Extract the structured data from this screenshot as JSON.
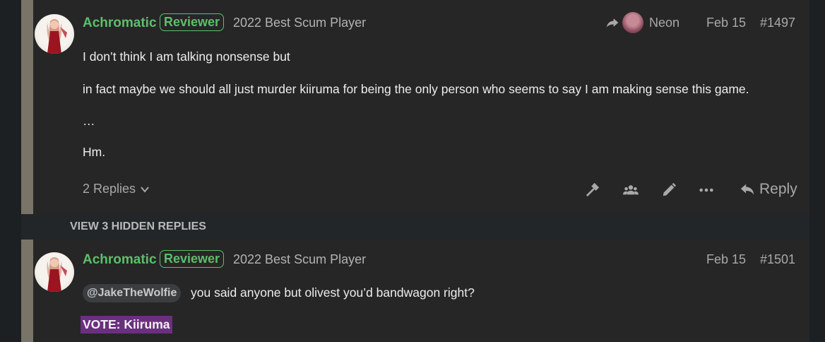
{
  "colors": {
    "username": "#5cbf6b",
    "page_bg": "#1d2023",
    "post_bg": "#262626",
    "left_bar": "#7a7468",
    "vote_bg": "#6b2f7f"
  },
  "post1": {
    "username": "Achromatic",
    "badge": "Reviewer",
    "user_title": "2022 Best Scum Player",
    "reply_to_name": "Neon",
    "date": "Feb 15",
    "post_number": "#1497",
    "lines": [
      "I don’t think I am talking nonsense but",
      "in fact maybe we should all just murder kiiruma for being the only person who seems to say I am making sense this game.",
      "…",
      "Hm."
    ],
    "replies_label": "2 Replies",
    "actions": [
      "hammer-icon",
      "group-icon",
      "pencil-icon",
      "more-icon"
    ],
    "reply_label": "Reply"
  },
  "hidden_replies": {
    "label": "VIEW 3 HIDDEN REPLIES"
  },
  "post2": {
    "username": "Achromatic",
    "badge": "Reviewer",
    "user_title": "2022 Best Scum Player",
    "date": "Feb 15",
    "post_number": "#1501",
    "mention": "@JakeTheWolfie",
    "text_after_mention": "you said anyone but olivest you’d bandwagon right?",
    "vote": "VOTE: Kiiruma"
  }
}
